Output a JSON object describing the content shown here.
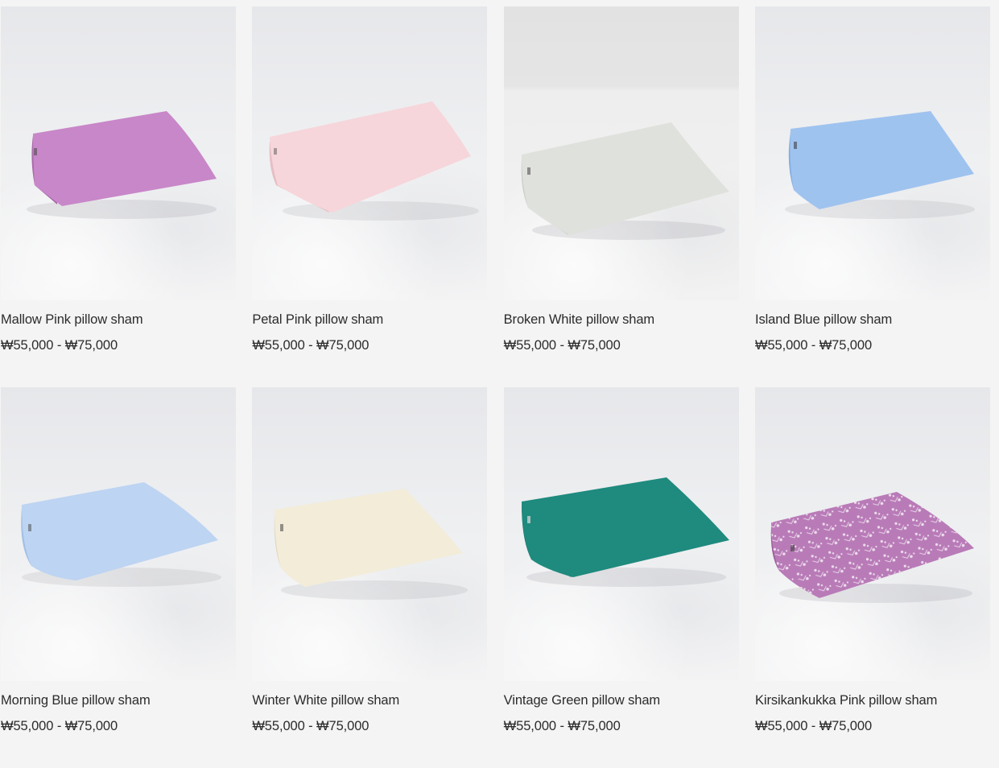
{
  "products": [
    {
      "name": "Mallow Pink pillow sham",
      "price": "₩55,000 - ₩75,000",
      "color": "#c887c8",
      "shade": "#a96aa9",
      "image": "mallow-pink-pillow-photo"
    },
    {
      "name": "Petal Pink pillow sham",
      "price": "₩55,000 - ₩75,000",
      "color": "#f6d6db",
      "shade": "#e7bfc5",
      "image": "petal-pink-pillow-photo"
    },
    {
      "name": "Broken White pillow sham",
      "price": "₩55,000 - ₩75,000",
      "color": "#dfe1dc",
      "shade": "#c9ccc6",
      "image": "broken-white-pillow-photo"
    },
    {
      "name": "Island Blue pillow sham",
      "price": "₩55,000 - ₩75,000",
      "color": "#9fc3ef",
      "shade": "#84aee0",
      "image": "island-blue-pillow-photo"
    },
    {
      "name": "Morning Blue pillow sham",
      "price": "₩55,000 - ₩75,000",
      "color": "#bdd4f2",
      "shade": "#a3c0e6",
      "image": "morning-blue-pillow-photo"
    },
    {
      "name": "Winter White pillow sham",
      "price": "₩55,000 - ₩75,000",
      "color": "#f2ecd9",
      "shade": "#e2dac2",
      "image": "winter-white-pillow-photo"
    },
    {
      "name": "Vintage Green pillow sham",
      "price": "₩55,000 - ₩75,000",
      "color": "#1f8a7e",
      "shade": "#146c62",
      "image": "vintage-green-pillow-photo"
    },
    {
      "name": "Kirsikankukka Pink pillow sham",
      "price": "₩55,000 - ₩75,000",
      "color": "#b97bb8",
      "shade": "#9a5d99",
      "image": "kirsikankukka-pink-pillow-photo"
    }
  ]
}
